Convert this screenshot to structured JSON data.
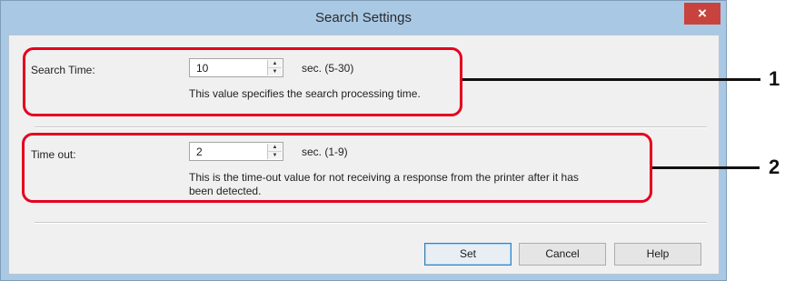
{
  "window": {
    "title": "Search Settings",
    "close_glyph": "×"
  },
  "search_time": {
    "label": "Search Time:",
    "value": "10",
    "unit": "sec. (5-30)",
    "description": "This value specifies the search processing time."
  },
  "time_out": {
    "label": "Time out:",
    "value": "2",
    "unit": "sec. (1-9)",
    "description_line1": "This is the time-out value for not receiving a response from the printer after it has",
    "description_line2": "been detected."
  },
  "buttons": {
    "set": "Set",
    "cancel": "Cancel",
    "help": "Help"
  },
  "callouts": {
    "first": "1",
    "second": "2"
  },
  "icons": {
    "spin_up": "up-arrow-icon",
    "spin_down": "down-arrow-icon",
    "close": "close-icon"
  },
  "colors": {
    "highlight": "#e4001f",
    "close_button": "#c9433e",
    "title_bar": "#a9c8e4"
  }
}
